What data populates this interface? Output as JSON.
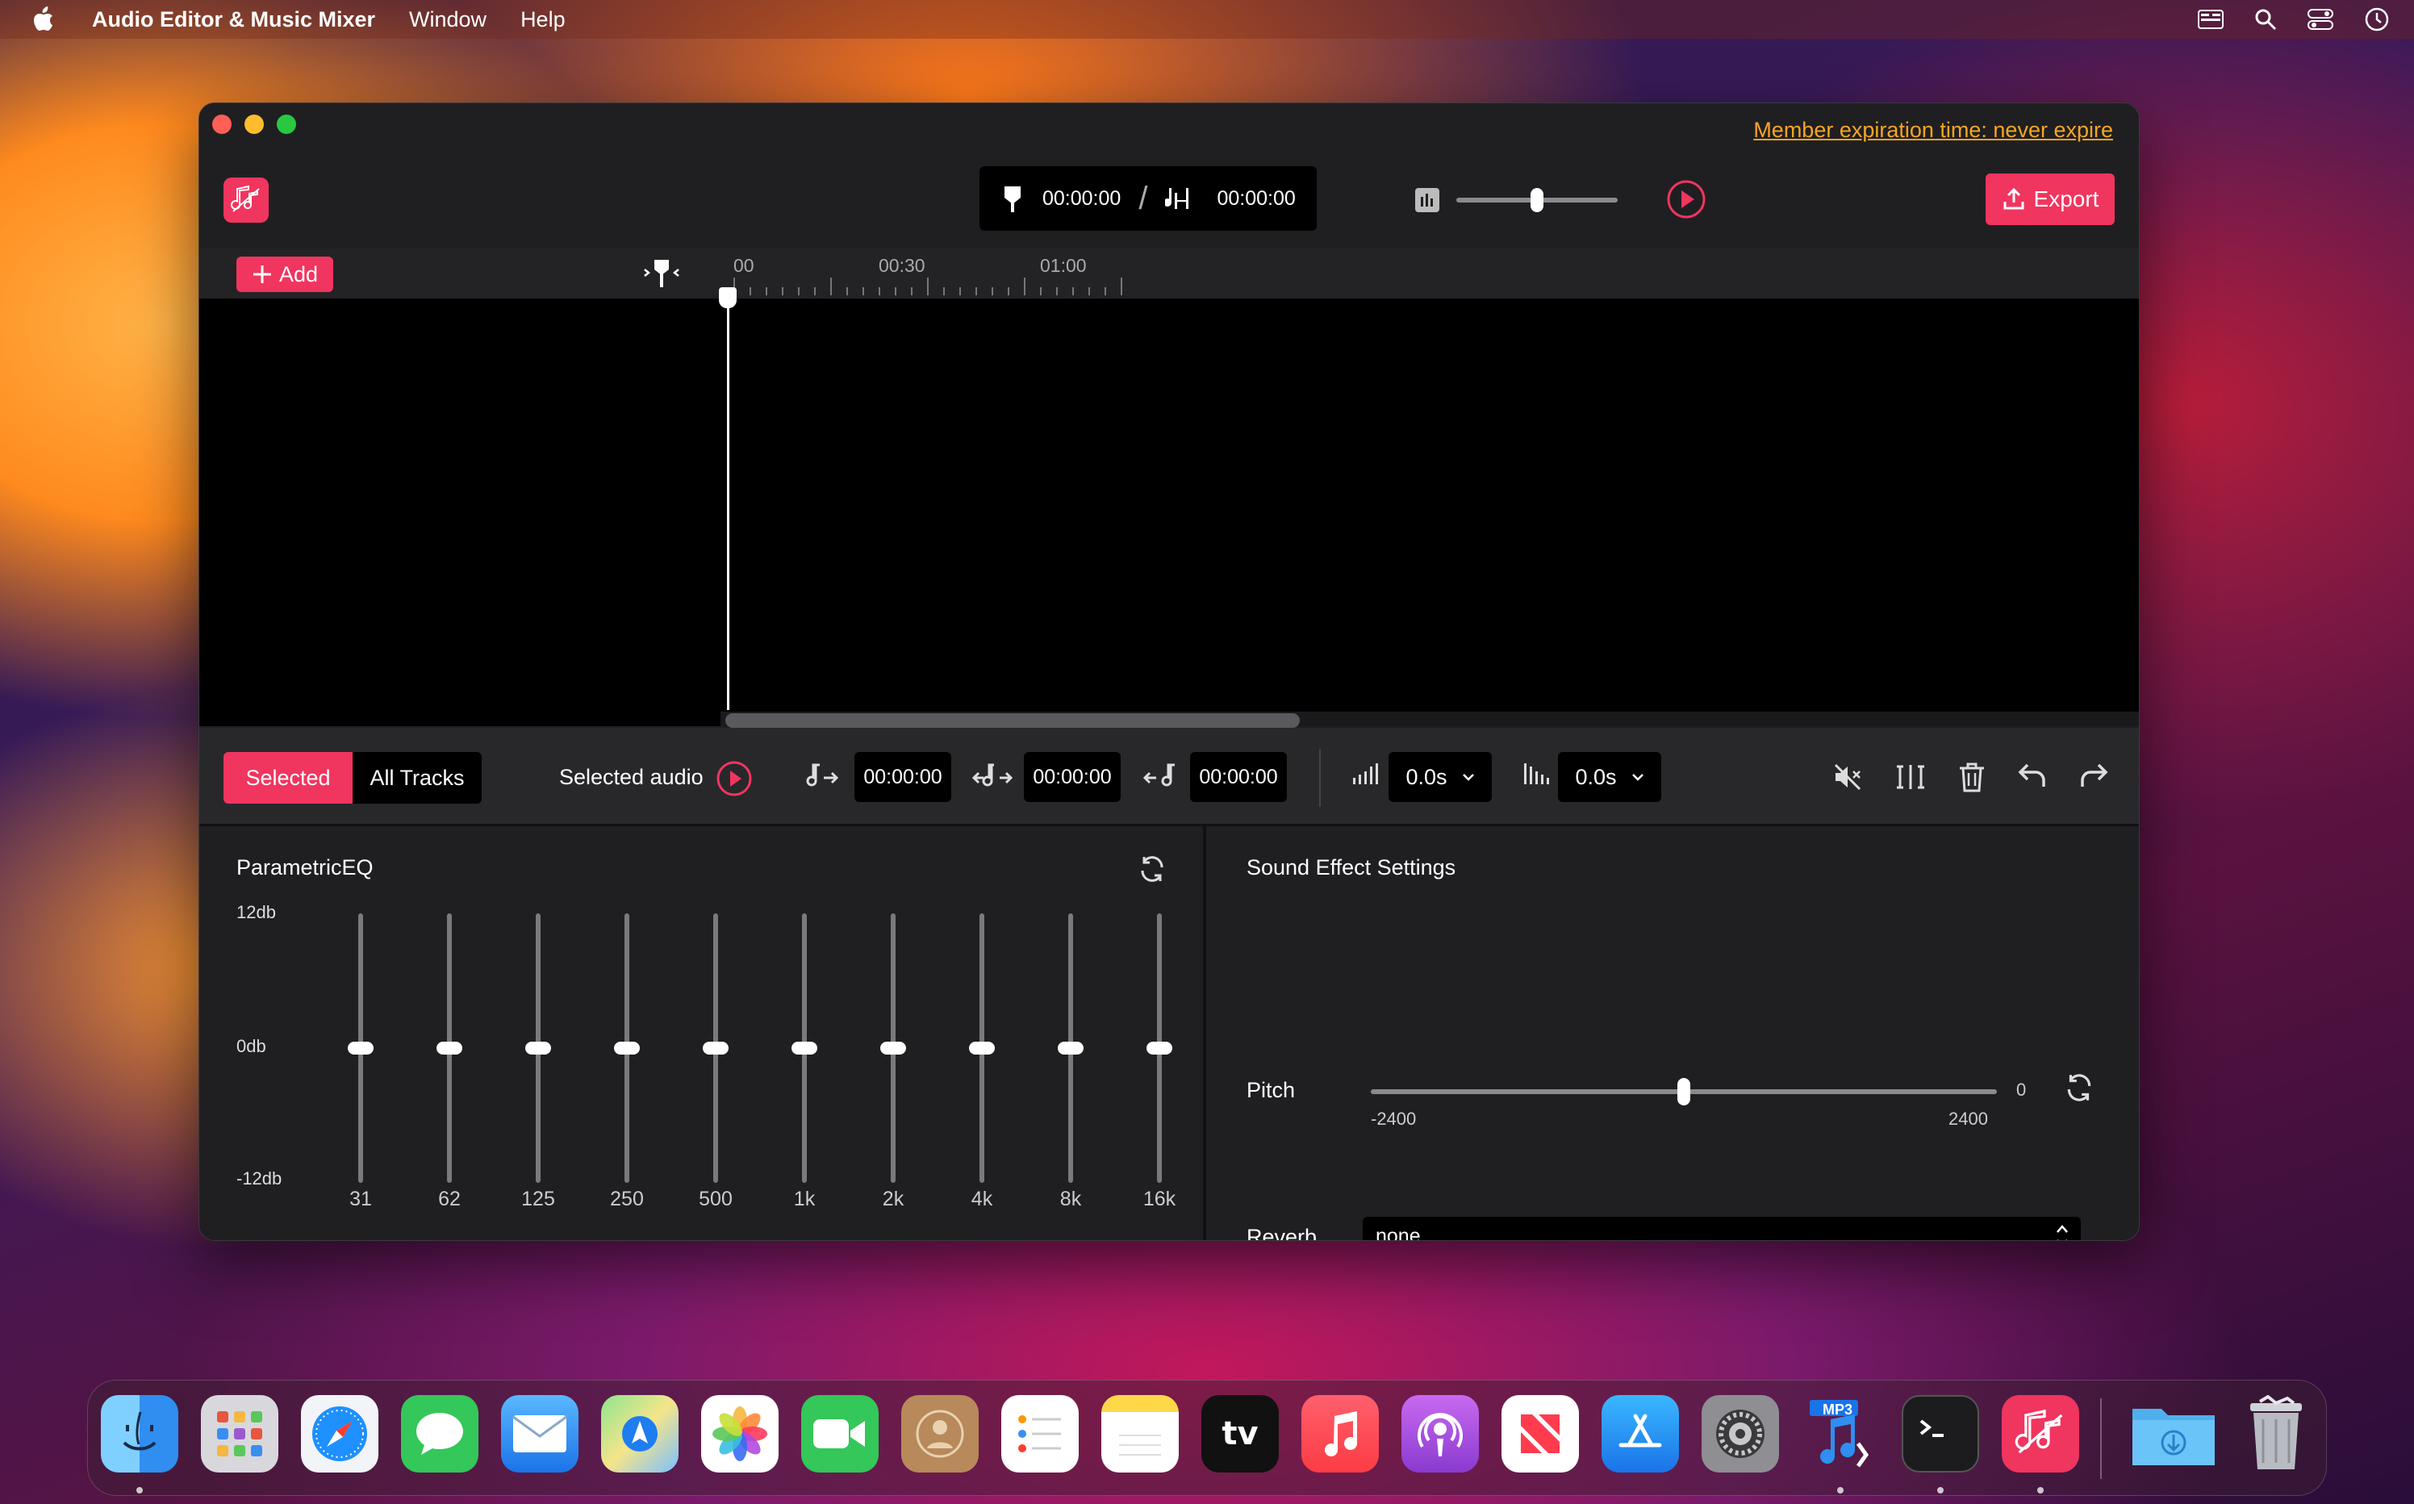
{
  "menubar": {
    "app_name": "Audio Editor & Music Mixer",
    "items": [
      "Window",
      "Help"
    ]
  },
  "window": {
    "member_link": "Member expiration time: never expire",
    "time_current": "00:00:00",
    "time_separator": "/",
    "time_total": "00:00:00",
    "volume_level": 0.5,
    "export_label": "Export",
    "add_label": "Add"
  },
  "ruler": {
    "labels": [
      "00",
      "00:30",
      "01:00"
    ]
  },
  "controls": {
    "tab_selected": "Selected",
    "tab_all": "All Tracks",
    "selected_audio_label": "Selected audio",
    "start_time": "00:00:00",
    "duration_time": "00:00:00",
    "end_time": "00:00:00",
    "fade_in": "0.0s",
    "fade_out": "0.0s"
  },
  "eq": {
    "title": "ParametricEQ",
    "db_top": "12db",
    "db_mid": "0db",
    "db_bottom": "-12db",
    "bands": [
      {
        "freq": "31",
        "gain_db": 0
      },
      {
        "freq": "62",
        "gain_db": 0
      },
      {
        "freq": "125",
        "gain_db": 0
      },
      {
        "freq": "250",
        "gain_db": 0
      },
      {
        "freq": "500",
        "gain_db": 0
      },
      {
        "freq": "1k",
        "gain_db": 0
      },
      {
        "freq": "2k",
        "gain_db": 0
      },
      {
        "freq": "4k",
        "gain_db": 0
      },
      {
        "freq": "8k",
        "gain_db": 0
      },
      {
        "freq": "16k",
        "gain_db": 0
      }
    ]
  },
  "fx": {
    "title": "Sound Effect Settings",
    "pitch_label": "Pitch",
    "pitch_value": "0",
    "pitch_min": "-2400",
    "pitch_max": "2400",
    "reverb_label": "Reverb",
    "reverb_value": "none"
  },
  "dock": {
    "apps": [
      "finder",
      "launchpad",
      "safari",
      "messages",
      "mail",
      "maps",
      "photos",
      "facetime",
      "contacts",
      "reminders",
      "notes",
      "apple-tv",
      "music",
      "podcasts",
      "news",
      "app-store",
      "system-settings",
      "mp3-converter",
      "terminal",
      "audio-editor",
      "downloads",
      "trash"
    ],
    "tv_text": "tv",
    "mp3_badge": "MP3"
  },
  "colors": {
    "accent": "#f0355f",
    "link": "#f5a623",
    "panel": "#1f1f22"
  }
}
